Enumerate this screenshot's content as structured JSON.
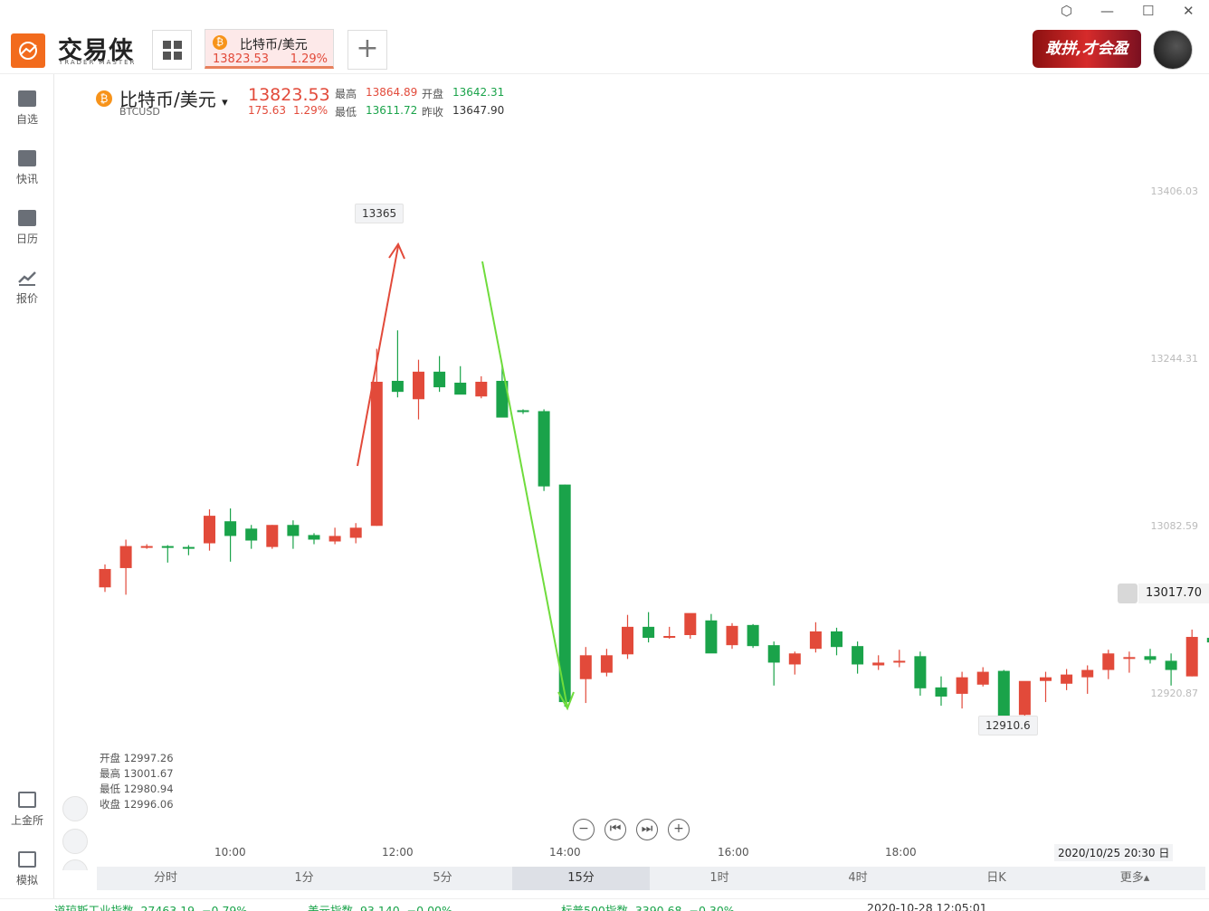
{
  "window": {
    "minimize_glyph": "—",
    "maximize_glyph": "☐",
    "close_glyph": "✕",
    "settings_glyph": "⬡"
  },
  "brand": {
    "name": "交易侠",
    "sub": "TRADER MASTER"
  },
  "tabs": [
    {
      "name": "比特币/美元",
      "price": "13823.53",
      "change_pct": "1.29%"
    }
  ],
  "add_tab_glyph": "+",
  "promo": {
    "text": "敢拼,才会盈"
  },
  "sidebar": [
    {
      "label": "自选",
      "icon": "bookmark-icon"
    },
    {
      "label": "快讯",
      "icon": "news-icon"
    },
    {
      "label": "日历",
      "icon": "calendar-icon"
    },
    {
      "label": "报价",
      "icon": "chart-line-icon"
    },
    {
      "label": "上金所",
      "icon": "sge-icon"
    },
    {
      "label": "模拟",
      "icon": "wallet-icon"
    }
  ],
  "instrument": {
    "coin_glyph": "₿",
    "name": "比特币/美元",
    "symbol": "BTCUSD",
    "price": "13823.53",
    "change": "175.63",
    "change_pct": "1.29%",
    "dropdown_glyph": "▾",
    "stats": {
      "high_label": "最高",
      "high": "13864.89",
      "open_label": "开盘",
      "open": "13642.31",
      "low_label": "最低",
      "low": "13611.72",
      "prev_label": "昨收",
      "prev": "13647.90"
    }
  },
  "ohlc_box": {
    "open": "开盘 12997.26",
    "high": "最高 13001.67",
    "low": "最低 12980.94",
    "close": "收盘 12996.06"
  },
  "callouts": {
    "peak": "13365",
    "trough": "12910.6"
  },
  "current_price": "13017.70",
  "date_tag": "2020/10/25 20:30 日",
  "nav_buttons": [
    "−",
    "⏮",
    "⏭",
    "+"
  ],
  "periods": [
    "分时",
    "1分",
    "5分",
    "15分",
    "1时",
    "4时",
    "日K",
    "更多▴"
  ],
  "active_period": "15分",
  "ticker": [
    {
      "name": "道琼斯工业指数",
      "value": "27463.19",
      "chg": "−0.79%"
    },
    {
      "name": "美元指数",
      "value": "93.140",
      "chg": "−0.00%"
    },
    {
      "name": "标普500指数",
      "value": "3390.68",
      "chg": "−0.30%"
    },
    {
      "name": "",
      "value": "2020-10-28 12:05:01",
      "chg": ""
    }
  ],
  "colors": {
    "up": "#e24a3a",
    "down": "#1aa34a",
    "accent": "#f26b1d"
  },
  "chart_data": {
    "type": "candlestick",
    "title": "",
    "x_ticks": [
      "10:00",
      "12:00",
      "14:00",
      "16:00",
      "18:00"
    ],
    "y_ticks": [
      "13406.03",
      "13244.31",
      "13082.59",
      "12920.87"
    ],
    "ylim": [
      12870,
      13560
    ],
    "candles": [
      {
        "o": 13060,
        "h": 13085,
        "l": 13055,
        "c": 13080
      },
      {
        "o": 13081,
        "h": 13112,
        "l": 13052,
        "c": 13105
      },
      {
        "o": 13105,
        "h": 13107,
        "l": 13102,
        "c": 13105
      },
      {
        "o": 13105,
        "h": 13106,
        "l": 13087,
        "c": 13103
      },
      {
        "o": 13104,
        "h": 13106,
        "l": 13095,
        "c": 13103
      },
      {
        "o": 13108,
        "h": 13145,
        "l": 13100,
        "c": 13138
      },
      {
        "o": 13132,
        "h": 13146,
        "l": 13088,
        "c": 13116
      },
      {
        "o": 13124,
        "h": 13128,
        "l": 13102,
        "c": 13111
      },
      {
        "o": 13104,
        "h": 13128,
        "l": 13102,
        "c": 13128
      },
      {
        "o": 13128,
        "h": 13133,
        "l": 13102,
        "c": 13116
      },
      {
        "o": 13117,
        "h": 13119,
        "l": 13107,
        "c": 13112
      },
      {
        "o": 13110,
        "h": 13125,
        "l": 13107,
        "c": 13116
      },
      {
        "o": 13114,
        "h": 13130,
        "l": 13108,
        "c": 13125
      },
      {
        "o": 13127,
        "h": 13320,
        "l": 13127,
        "c": 13284
      },
      {
        "o": 13285,
        "h": 13340,
        "l": 13267,
        "c": 13273
      },
      {
        "o": 13265,
        "h": 13308,
        "l": 13243,
        "c": 13295
      },
      {
        "o": 13295,
        "h": 13312,
        "l": 13273,
        "c": 13278
      },
      {
        "o": 13283,
        "h": 13301,
        "l": 13272,
        "c": 13270
      },
      {
        "o": 13268,
        "h": 13290,
        "l": 13266,
        "c": 13284
      },
      {
        "o": 13285,
        "h": 13303,
        "l": 13250,
        "c": 13245
      },
      {
        "o": 13253,
        "h": 13254,
        "l": 13249,
        "c": 13251
      },
      {
        "o": 13252,
        "h": 13254,
        "l": 13165,
        "c": 13170
      },
      {
        "o": 13172,
        "h": 13172,
        "l": 12930,
        "c": 12935
      },
      {
        "o": 12960,
        "h": 12995,
        "l": 12934,
        "c": 12986
      },
      {
        "o": 12967,
        "h": 12993,
        "l": 12963,
        "c": 12986
      },
      {
        "o": 12987,
        "h": 13030,
        "l": 12982,
        "c": 13017
      },
      {
        "o": 13017,
        "h": 13033,
        "l": 13000,
        "c": 13005
      },
      {
        "o": 13006,
        "h": 13017,
        "l": 13004,
        "c": 13007
      },
      {
        "o": 13008,
        "h": 13021,
        "l": 13004,
        "c": 13032
      },
      {
        "o": 13024,
        "h": 13031,
        "l": 12991,
        "c": 12988
      },
      {
        "o": 12997,
        "h": 13021,
        "l": 12993,
        "c": 13018
      },
      {
        "o": 13019,
        "h": 13020,
        "l": 12994,
        "c": 12996
      },
      {
        "o": 12997,
        "h": 13001,
        "l": 12953,
        "c": 12978
      },
      {
        "o": 12976,
        "h": 12990,
        "l": 12965,
        "c": 12988
      },
      {
        "o": 12993,
        "h": 13022,
        "l": 12989,
        "c": 13012
      },
      {
        "o": 13012,
        "h": 13016,
        "l": 12986,
        "c": 12995
      },
      {
        "o": 12996,
        "h": 13001,
        "l": 12966,
        "c": 12976
      },
      {
        "o": 12975,
        "h": 12986,
        "l": 12970,
        "c": 12978
      },
      {
        "o": 12978,
        "h": 12992,
        "l": 12973,
        "c": 12980
      },
      {
        "o": 12985,
        "h": 12990,
        "l": 12942,
        "c": 12950
      },
      {
        "o": 12951,
        "h": 12963,
        "l": 12931,
        "c": 12941
      },
      {
        "o": 12944,
        "h": 12968,
        "l": 12928,
        "c": 12962
      },
      {
        "o": 12954,
        "h": 12973,
        "l": 12952,
        "c": 12968
      },
      {
        "o": 12969,
        "h": 12970,
        "l": 12916,
        "c": 12916
      },
      {
        "o": 12921,
        "h": 12950,
        "l": 12912,
        "c": 12958
      },
      {
        "o": 12958,
        "h": 12968,
        "l": 12935,
        "c": 12962
      },
      {
        "o": 12955,
        "h": 12971,
        "l": 12948,
        "c": 12965
      },
      {
        "o": 12962,
        "h": 12975,
        "l": 12944,
        "c": 12970
      },
      {
        "o": 12970,
        "h": 12992,
        "l": 12960,
        "c": 12988
      },
      {
        "o": 12983,
        "h": 12990,
        "l": 12967,
        "c": 12984
      },
      {
        "o": 12985,
        "h": 12993,
        "l": 12977,
        "c": 12981
      },
      {
        "o": 12980,
        "h": 12988,
        "l": 12953,
        "c": 12970
      },
      {
        "o": 12963,
        "h": 13014,
        "l": 12963,
        "c": 13006
      },
      {
        "o": 13005,
        "h": 13009,
        "l": 12999,
        "c": 13000
      }
    ]
  }
}
